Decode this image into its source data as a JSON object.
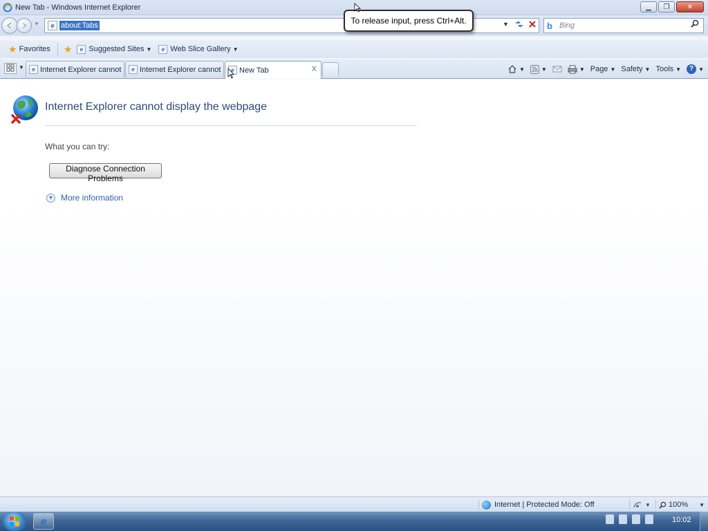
{
  "window": {
    "title": "New Tab - Windows Internet Explorer",
    "controls": {
      "minimize": "▁",
      "maximize": "❐",
      "close": "✕"
    }
  },
  "tooltip": {
    "text": "To release input, press Ctrl+Alt."
  },
  "address_bar": {
    "value": "about:Tabs"
  },
  "search": {
    "placeholder": "Bing"
  },
  "favorites_bar": {
    "favorites_label": "Favorites",
    "items": [
      {
        "label": "Suggested Sites"
      },
      {
        "label": "Web Slice Gallery"
      }
    ]
  },
  "tabs": [
    {
      "label": "Internet Explorer cannot di..."
    },
    {
      "label": "Internet Explorer cannot di..."
    },
    {
      "label": "New Tab",
      "close": "X"
    }
  ],
  "command_bar": {
    "page": "Page",
    "safety": "Safety",
    "tools": "Tools",
    "help": "?"
  },
  "error_page": {
    "title": "Internet Explorer cannot display the webpage",
    "try_label": "What you can try:",
    "diagnose_button": "Diagnose Connection Problems",
    "more_info": "More information"
  },
  "status_bar": {
    "zone": "Internet | Protected Mode: Off",
    "zoom": "100%"
  },
  "taskbar": {
    "clock": "10:02"
  },
  "icons": {
    "back": "back-arrow-icon",
    "forward": "forward-arrow-icon",
    "refresh": "refresh-icon",
    "stop": "stop-icon",
    "search": "magnifier-icon",
    "favorites": "star-icon",
    "home": "home-icon",
    "feeds": "rss-feed-icon",
    "mail": "read-mail-icon",
    "print": "printer-icon",
    "error": "globe-with-red-x-icon"
  },
  "colors": {
    "title_text": "#2a4a76",
    "link": "#2f5fa8",
    "selection": "#3a74c7",
    "stop_red": "#c7261a"
  }
}
